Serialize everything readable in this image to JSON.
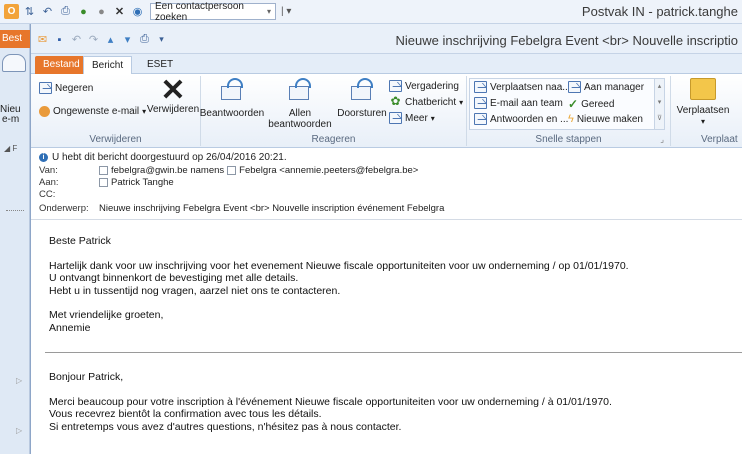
{
  "outer_window": {
    "title": "Postvak IN - patrick.tanghe",
    "contact_search_placeholder": "Een contactpersoon zoeken",
    "left_tab_label": "Best",
    "left_labels": [
      "Nieu",
      "e-m"
    ]
  },
  "message_window": {
    "title": "Nieuwe inschrijving Febelgra Event <br> Nouvelle inscriptio",
    "tabs": {
      "file": "Bestand",
      "message": "Bericht",
      "eset": "ESET"
    }
  },
  "ribbon": {
    "groups": {
      "delete": "Verwijderen",
      "respond": "Reageren",
      "quick_steps": "Snelle stappen",
      "move": "Verplaat"
    },
    "delete": {
      "ignore": "Negeren",
      "junk": "Ongewenste e-mail",
      "delete": "Verwijderen"
    },
    "respond": {
      "reply": "Beantwoorden",
      "reply_all_line1": "Allen",
      "reply_all_line2": "beantwoorden",
      "forward": "Doorsturen",
      "meeting": "Vergadering",
      "chat": "Chatbericht",
      "more": "Meer"
    },
    "quick_steps": {
      "move_to": "Verplaatsen naa...",
      "to_manager": "Aan manager",
      "team_email": "E-mail aan team",
      "done": "Gereed",
      "reply_delete": "Antwoorden en ...",
      "create_new": "Nieuwe maken"
    },
    "move": {
      "move": "Verplaatsen"
    }
  },
  "header": {
    "info": "U hebt dit bericht doorgestuurd op 26/04/2016 20:21.",
    "from_label": "Van:",
    "from_value": "febelgra@gwin.be namens",
    "from_value2": "Febelgra <annemie.peeters@febelgra.be>",
    "to_label": "Aan:",
    "to_value": "Patrick Tanghe",
    "cc_label": "CC:",
    "subject_label": "Onderwerp:",
    "subject_value": "Nieuwe inschrijving Febelgra Event <br> Nouvelle inscription événement Febelgra"
  },
  "body": {
    "nl_greeting": "Beste Patrick",
    "nl_line1": "Hartelijk dank voor uw inschrijving voor het evenement Nieuwe fiscale opportuniteiten voor uw onderneming / op 01/01/1970.",
    "nl_line2": "U ontvangt binnenkort de bevestiging met alle details.",
    "nl_line3": "Hebt u in tussentijd nog vragen, aarzel niet ons te contacteren.",
    "nl_closing": "Met vriendelijke groeten,",
    "nl_signature": "Annemie",
    "fr_greeting": "Bonjour Patrick,",
    "fr_line1": "Merci beaucoup pour votre inscription à l'événement Nieuwe fiscale opportuniteiten voor uw onderneming / à 01/01/1970.",
    "fr_line2": "Vous recevrez bientôt la confirmation avec tous les détails.",
    "fr_line3": "Si entretemps vous avez d'autres questions, n'hésitez pas à nous contacter."
  }
}
